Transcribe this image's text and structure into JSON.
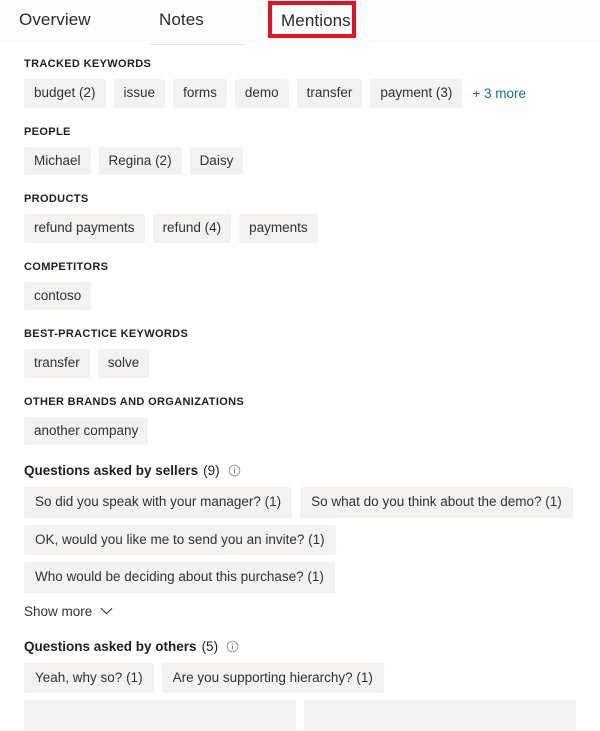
{
  "tabs": [
    {
      "id": "overview",
      "label": "Overview",
      "selected": false
    },
    {
      "id": "notes",
      "label": "Notes",
      "selected": false
    },
    {
      "id": "mentions",
      "label": "Mentions",
      "selected": true
    }
  ],
  "annotation": {
    "target": "Mentions",
    "color": "#e81123"
  },
  "colors": {
    "chip_background": "#f3f2f1",
    "link": "#0f6cbd",
    "text": "#323130",
    "label": "#201f1e",
    "page_background": "#ffffff"
  },
  "sections": [
    {
      "id": "tracked-keywords",
      "label": "TRACKED KEYWORDS",
      "chips": [
        "budget (2)",
        "issue",
        "forms",
        "demo",
        "transfer",
        "payment (3)"
      ],
      "more_link": "+ 3 more"
    },
    {
      "id": "people",
      "label": "PEOPLE",
      "chips": [
        "Michael",
        "Regina (2)",
        "Daisy"
      ],
      "more_link": null
    },
    {
      "id": "products",
      "label": "PRODUCTS",
      "chips": [
        "refund payments",
        "refund (4)",
        "payments"
      ],
      "more_link": null
    },
    {
      "id": "competitors",
      "label": "COMPETITORS",
      "chips": [
        "contoso"
      ],
      "more_link": null
    },
    {
      "id": "best-practice-keywords",
      "label": "BEST-PRACTICE KEYWORDS",
      "chips": [
        "transfer",
        "solve"
      ],
      "more_link": null
    },
    {
      "id": "other-brands",
      "label": "OTHER BRANDS AND ORGANIZATIONS",
      "chips": [
        "another company"
      ],
      "more_link": null
    }
  ],
  "question_groups": [
    {
      "id": "questions-by-sellers",
      "title": "Questions asked by sellers",
      "count": "(9)",
      "info_icon": "info-circle-icon",
      "chips": [
        "So did you speak with your manager? (1)",
        "So what do you think about the demo? (1)",
        "OK, would you like me to send you an invite? (1)",
        "Who would be deciding about this purchase? (1)"
      ],
      "show_more_label": "Show more",
      "show_more_icon": "chevron-down-icon"
    },
    {
      "id": "questions-by-others",
      "title": "Questions asked by others",
      "count": "(5)",
      "info_icon": "info-circle-icon",
      "chips": [
        "Yeah, why so? (1)",
        "Are you supporting hierarchy? (1)"
      ],
      "show_more_label": null,
      "show_more_icon": null
    }
  ]
}
